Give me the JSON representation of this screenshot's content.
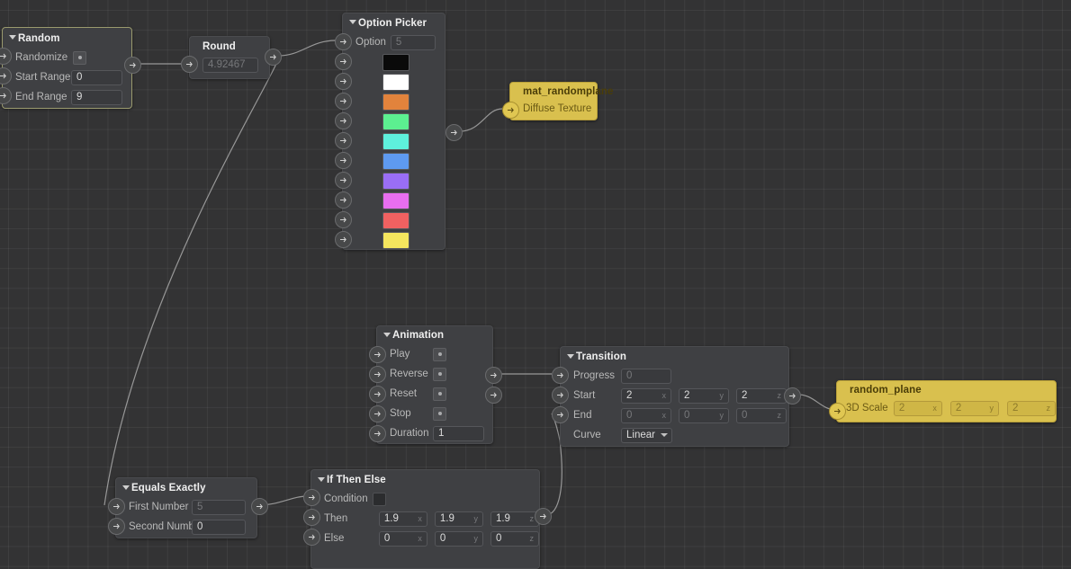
{
  "app": {
    "kind": "node-graph-editor",
    "background": "#333334"
  },
  "colors": {
    "node_body": "#3f4043",
    "node_gold": "#d9c04e",
    "wire": "#a9a9a9",
    "selected_border": "#9a9a6e"
  },
  "icons": {
    "port": "arrow-right-icon",
    "collapse": "triangle-down-icon",
    "dropdown": "chevron-down-icon"
  },
  "nodes": {
    "random": {
      "title": "Random",
      "rows": [
        {
          "label": "Randomize",
          "kind": "button"
        },
        {
          "label": "Start Range",
          "value": "0",
          "dim": false
        },
        {
          "label": "End Range",
          "value": "9",
          "dim": false
        }
      ]
    },
    "round": {
      "title": "Round",
      "value": "4.92467"
    },
    "option_picker": {
      "title": "Option Picker",
      "option_label": "Option",
      "option_value": "5",
      "swatches": [
        "#0a0a0a",
        "#ffffff",
        "#e2833c",
        "#5cf090",
        "#5ef0dc",
        "#5e9af0",
        "#9a6ef5",
        "#e86ef0",
        "#f06161",
        "#f5e65e"
      ]
    },
    "material": {
      "title": "mat_randomplane",
      "rows": [
        {
          "label": "Diffuse Texture"
        }
      ]
    },
    "animation": {
      "title": "Animation",
      "rows": [
        {
          "label": "Play",
          "kind": "button"
        },
        {
          "label": "Reverse",
          "kind": "button"
        },
        {
          "label": "Reset",
          "kind": "button"
        },
        {
          "label": "Stop",
          "kind": "button"
        },
        {
          "label": "Duration",
          "value": "1",
          "dim": false
        }
      ]
    },
    "transition": {
      "title": "Transition",
      "progress": {
        "label": "Progress",
        "value": "0",
        "dim": true
      },
      "start": {
        "label": "Start",
        "values": [
          "2",
          "2",
          "2"
        ],
        "dim": false
      },
      "end": {
        "label": "End",
        "values": [
          "0",
          "0",
          "0"
        ],
        "dim": true
      },
      "curve": {
        "label": "Curve",
        "value": "Linear"
      },
      "axes": [
        "x",
        "y",
        "z"
      ]
    },
    "random_plane": {
      "title": "random_plane",
      "scale": {
        "label": "3D Scale",
        "values": [
          "2",
          "2",
          "2"
        ],
        "dim": true
      },
      "axes": [
        "x",
        "y",
        "z"
      ]
    },
    "equals_exactly": {
      "title": "Equals Exactly",
      "rows": [
        {
          "label": "First Number",
          "value": "5",
          "dim": true
        },
        {
          "label": "Second Number",
          "value": "0",
          "dim": false
        }
      ]
    },
    "if_then_else": {
      "title": "If Then Else",
      "condition_label": "Condition",
      "then": {
        "label": "Then",
        "values": [
          "1.9",
          "1.9",
          "1.9"
        ],
        "dim": false
      },
      "else": {
        "label": "Else",
        "values": [
          "0",
          "0",
          "0"
        ],
        "dim": false
      },
      "axes": [
        "x",
        "y",
        "z"
      ]
    }
  }
}
